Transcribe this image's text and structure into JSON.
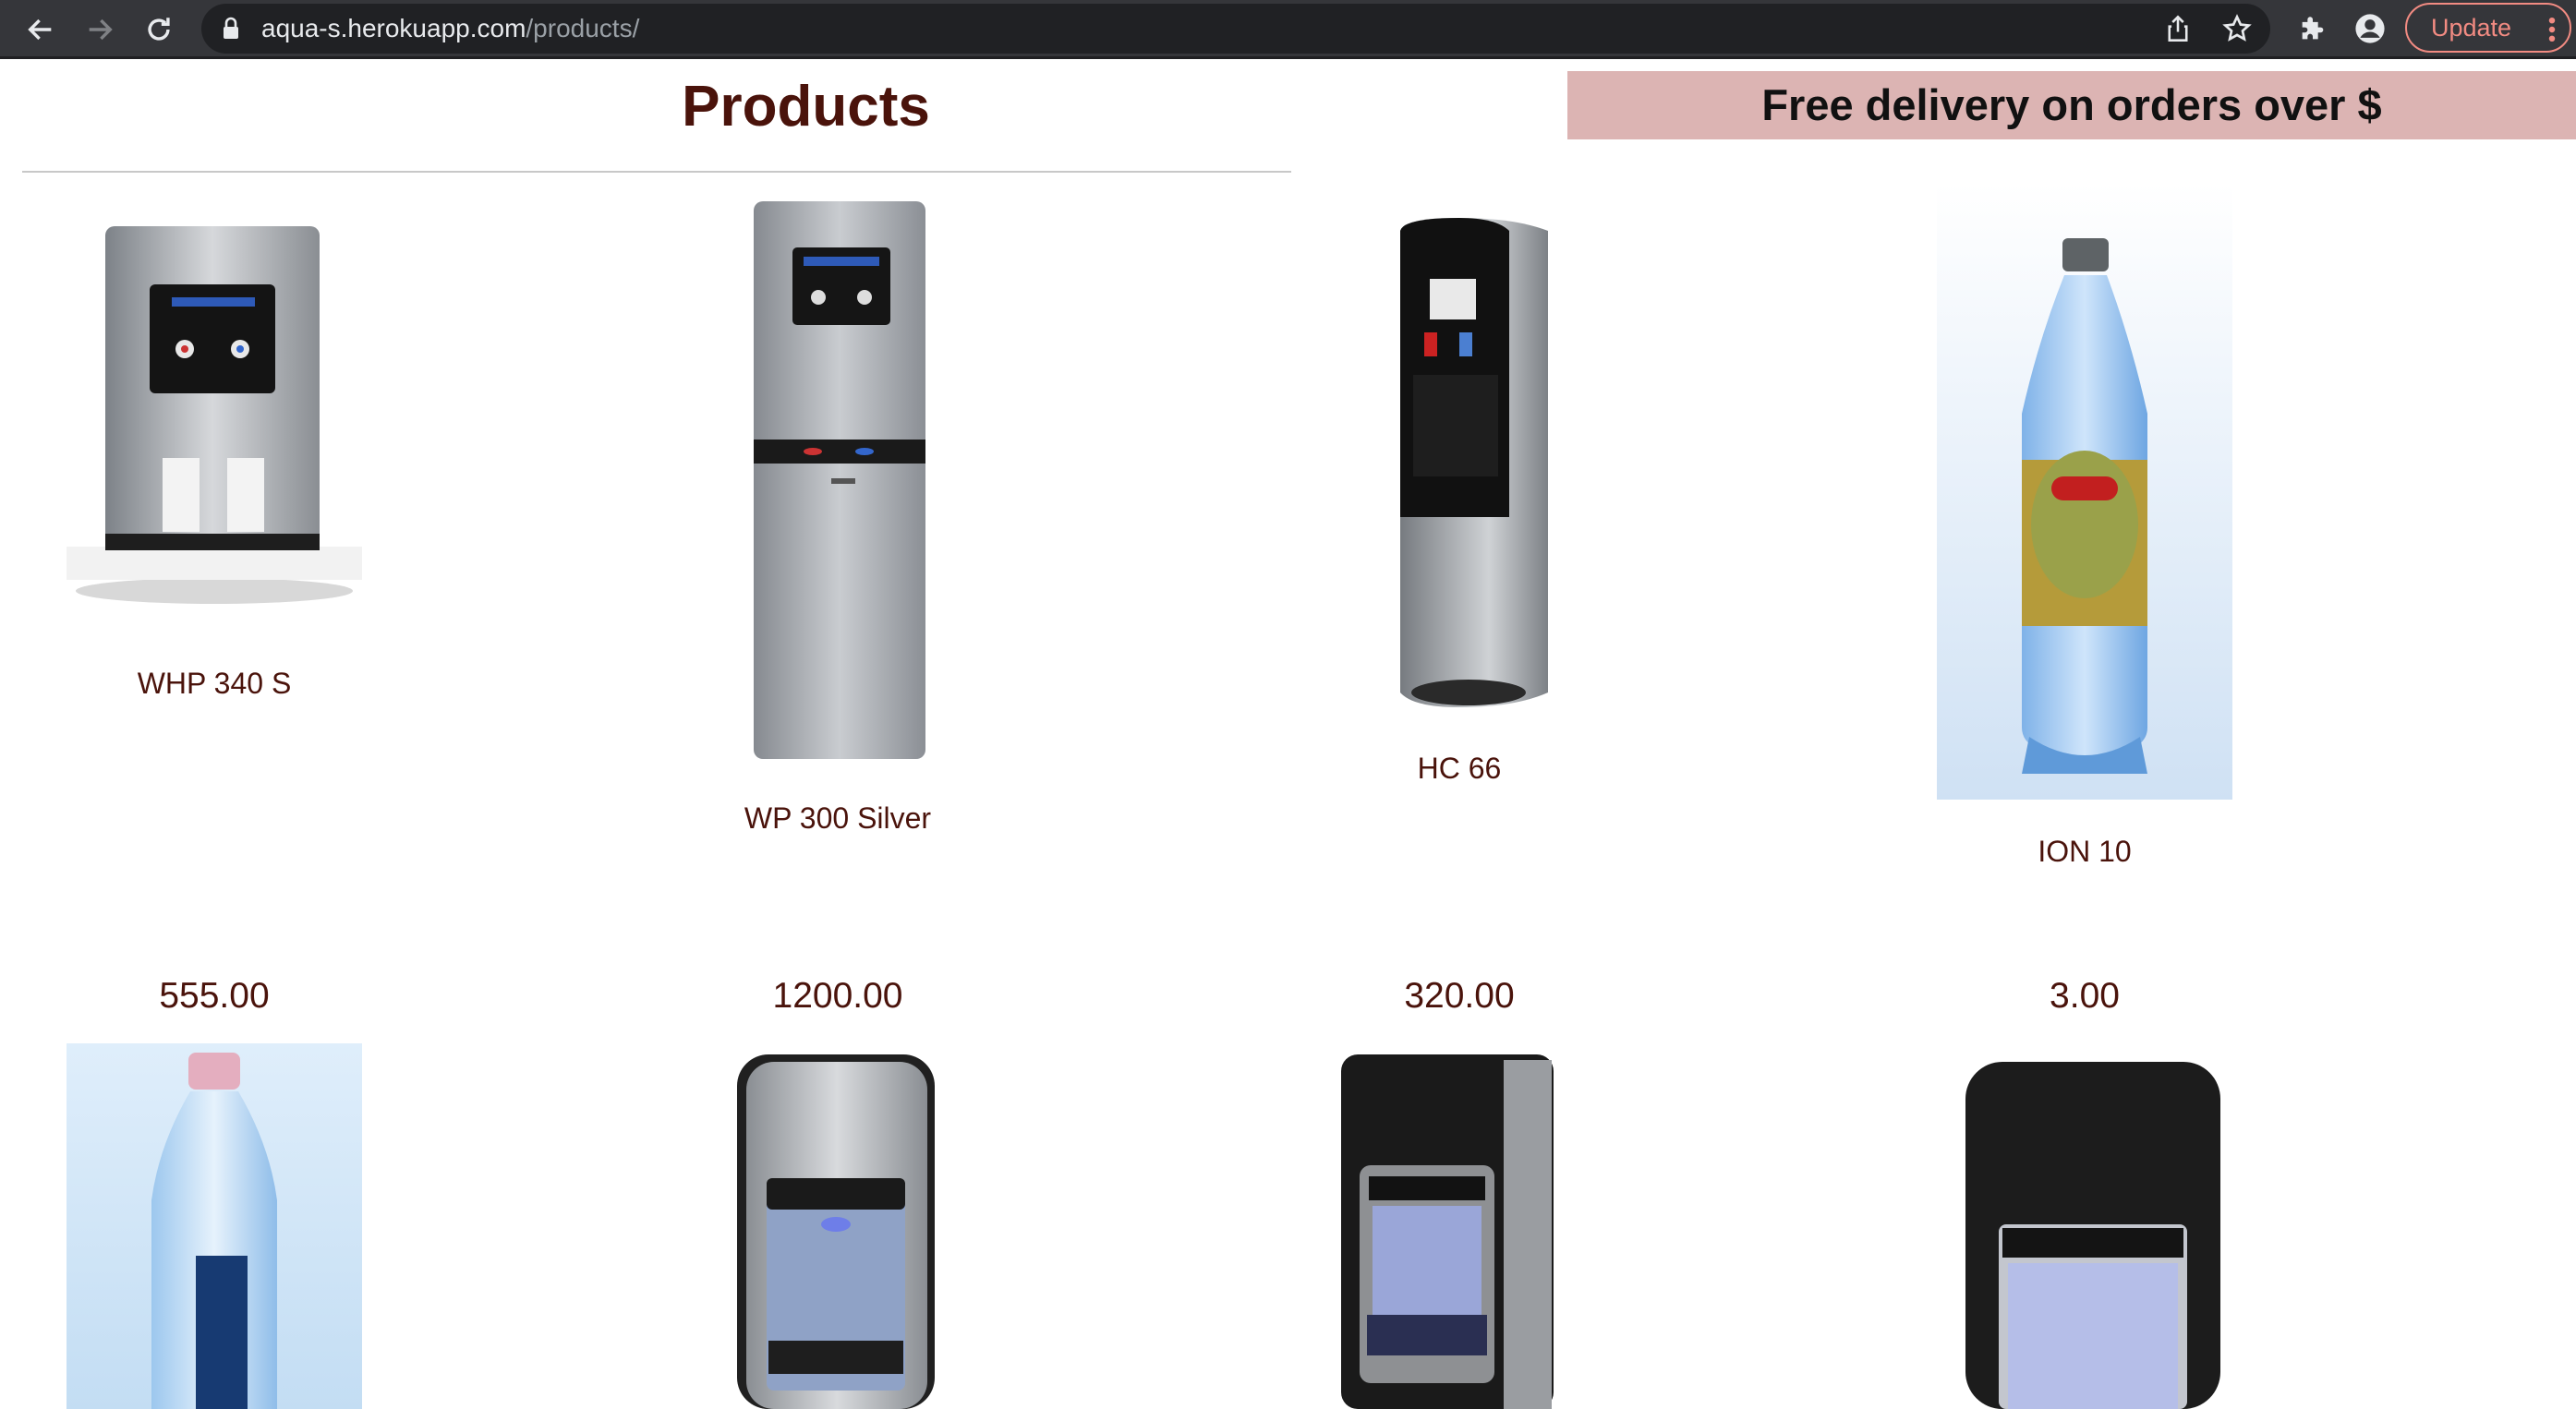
{
  "browser": {
    "url_host": "aqua-s.herokuapp.com",
    "url_path": "/products/",
    "update_label": "Update"
  },
  "page": {
    "title": "Products",
    "banner": "Free delivery on orders over $"
  },
  "products": [
    {
      "name": "WHP 340 S",
      "price": "555.00",
      "icon": "countertop-water-dispenser"
    },
    {
      "name": "WP 300 Silver",
      "price": "1200.00",
      "icon": "floor-water-dispenser-silver"
    },
    {
      "name": "HC 66",
      "price": "320.00",
      "icon": "water-cooler-black-silver"
    },
    {
      "name": "ION 10",
      "price": "3.00",
      "icon": "water-bottle-large"
    }
  ],
  "second_row": [
    {
      "icon": "ion-water-bottle"
    },
    {
      "icon": "water-dispenser-silver"
    },
    {
      "icon": "water-dispenser-black"
    },
    {
      "icon": "water-dispenser-black-wide"
    }
  ],
  "colors": {
    "title": "#4a130b",
    "banner_bg": "#dcb4b3",
    "chrome_bg": "#35363a",
    "update_accent": "#f28b82"
  }
}
